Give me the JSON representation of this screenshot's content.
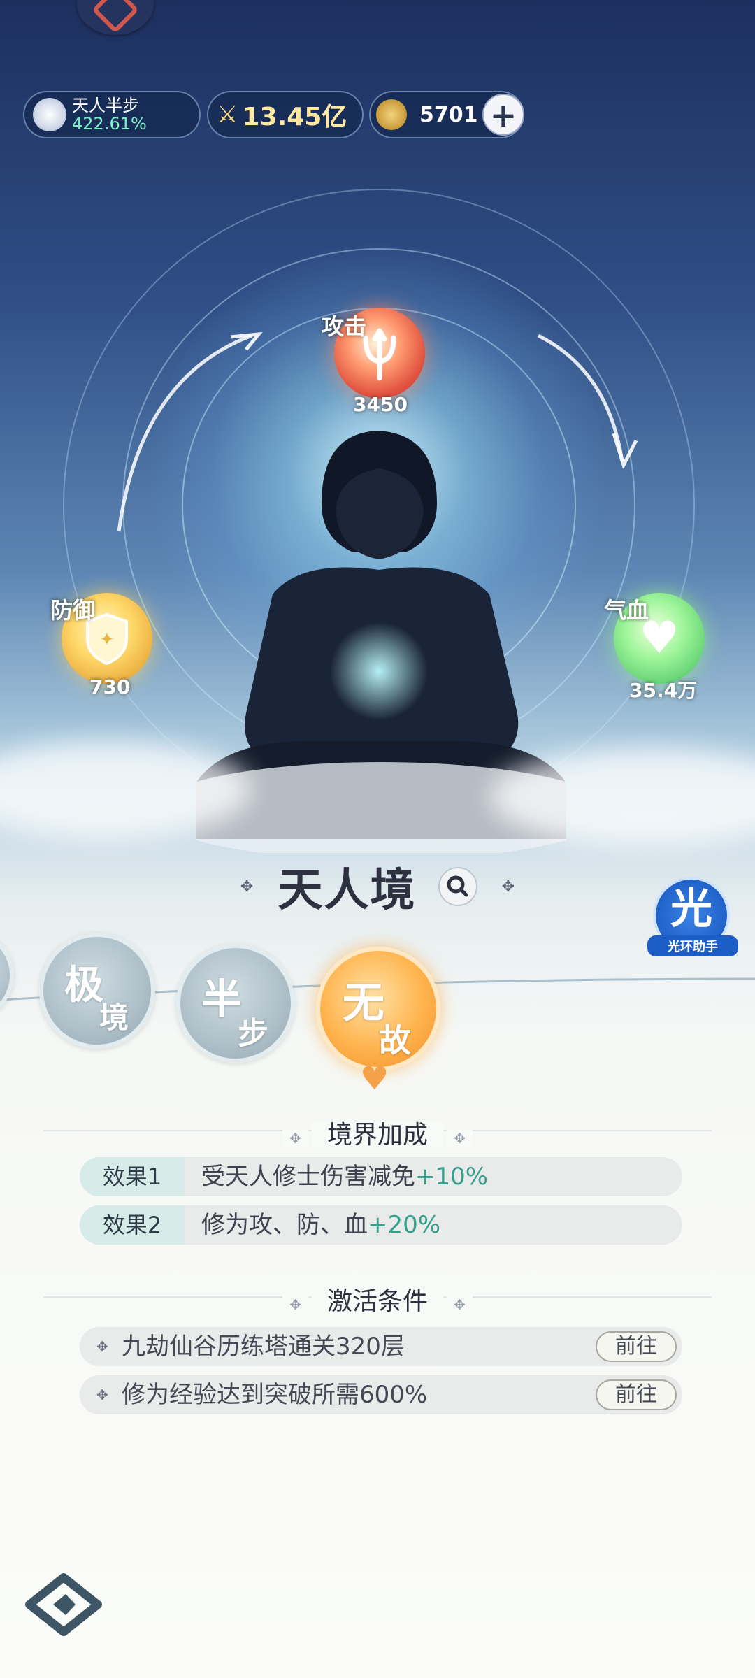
{
  "status_bar": {
    "realm_name": "天人半步",
    "realm_progress": "422.61%",
    "combat_power": "13.45亿",
    "currency_amount": "5701",
    "add_button_label": "+"
  },
  "stats": {
    "attack": {
      "label": "攻击",
      "value": "3450",
      "icon": "trident-icon"
    },
    "defense": {
      "label": "防御",
      "value": "730",
      "icon": "shield-icon"
    },
    "hp": {
      "label": "气血",
      "value": "35.4万",
      "icon": "heart-icon"
    }
  },
  "realm": {
    "title": "天人境",
    "stages": [
      {
        "line1": "极",
        "line2": "境",
        "active": false
      },
      {
        "line1": "半",
        "line2": "步",
        "active": false
      },
      {
        "line1": "无",
        "line2": "故",
        "active": true
      }
    ]
  },
  "helper": {
    "badge": "光",
    "label": "光环助手"
  },
  "bonus": {
    "heading": "境界加成",
    "effects": [
      {
        "tag": "效果1",
        "text": "受天人修士伤害减免",
        "bonus": "+10%"
      },
      {
        "tag": "效果2",
        "text": "修为攻、防、血",
        "bonus": "+20%"
      }
    ]
  },
  "activation": {
    "heading": "激活条件",
    "conditions": [
      {
        "text": "九劫仙谷历练塔通关320层",
        "button": "前往"
      },
      {
        "text": "修为经验达到突破所需600%",
        "button": "前往"
      }
    ]
  },
  "colors": {
    "accent_orange": "#f4a24a",
    "bonus_green": "#34a08c",
    "progress_green": "#7ef0c4",
    "power_gold": "#ffe8a0"
  }
}
